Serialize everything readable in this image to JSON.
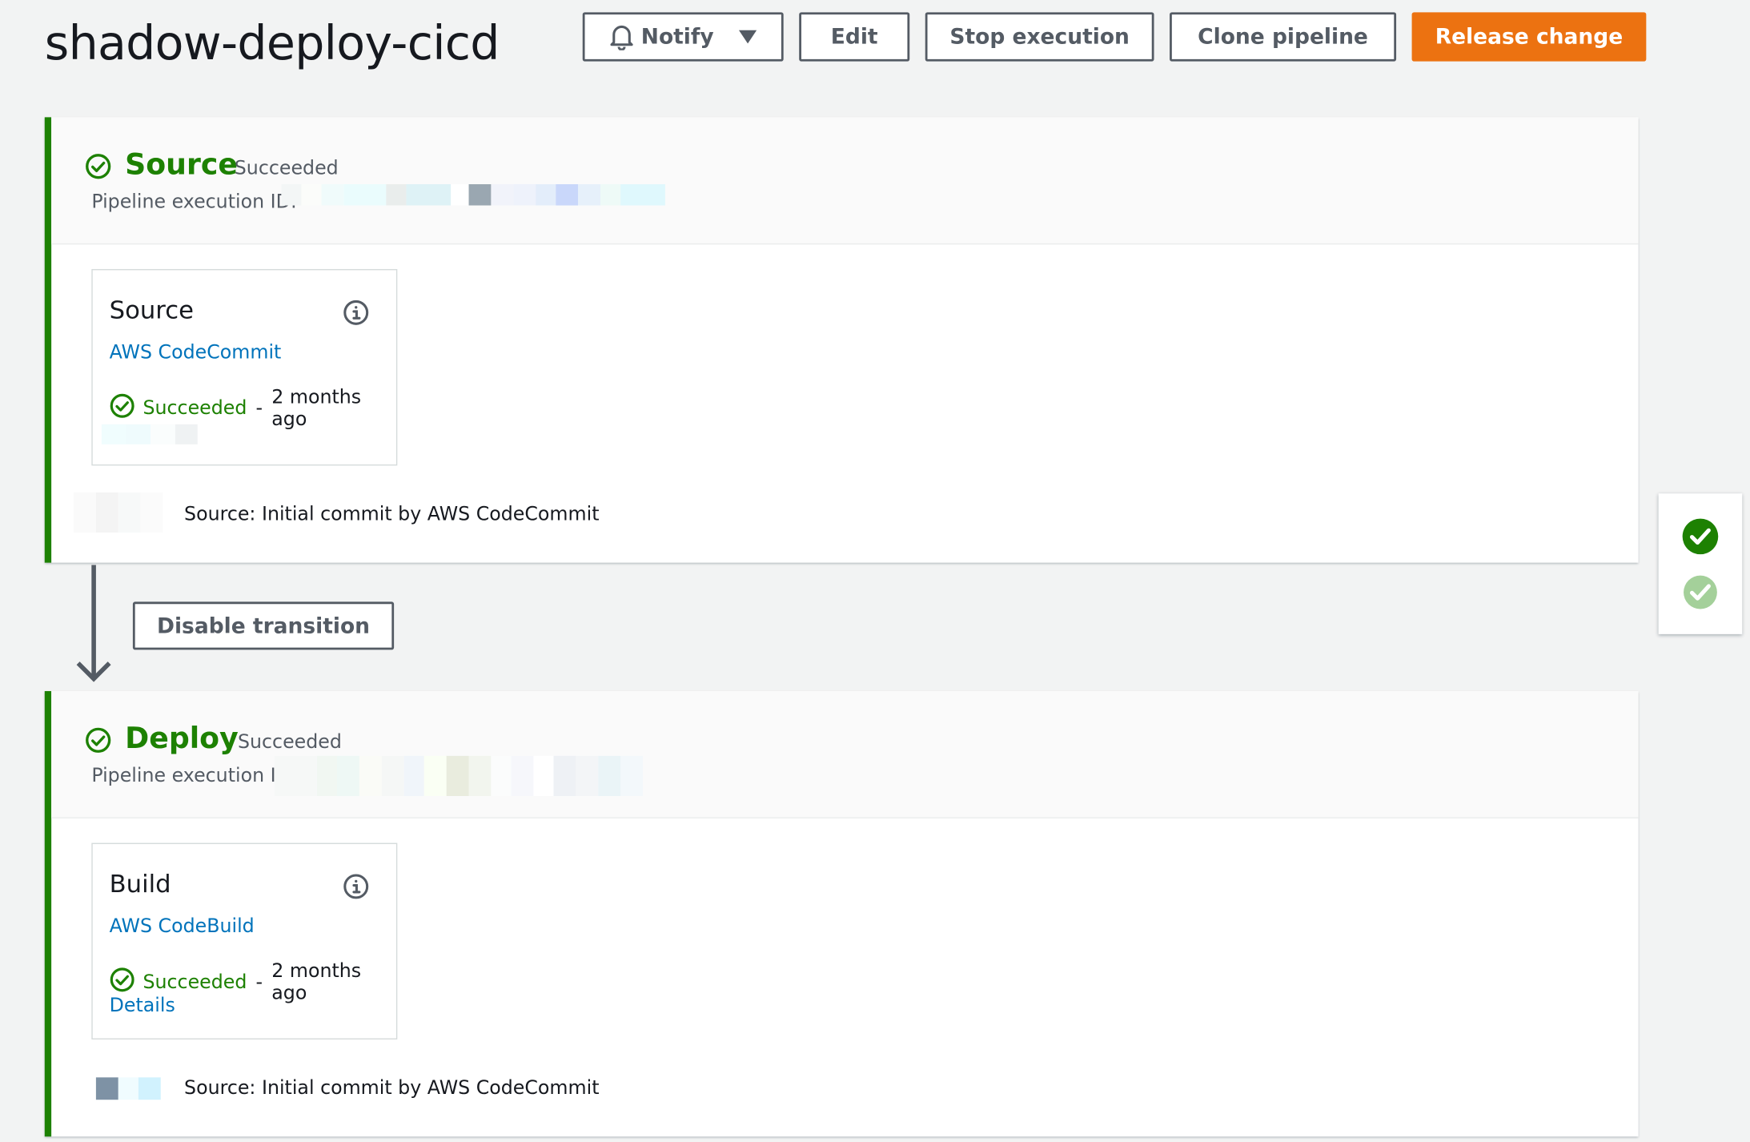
{
  "header": {
    "title": "shadow-deploy-cicd",
    "buttons": {
      "notify": "Notify",
      "edit": "Edit",
      "stop": "Stop execution",
      "clone": "Clone pipeline",
      "release": "Release change"
    }
  },
  "colors": {
    "success": "#1d8102",
    "link": "#0073bb",
    "primary": "#ec7211",
    "muted": "#545b64"
  },
  "stages": [
    {
      "name": "Source",
      "status": "Succeeded",
      "exec_label": "Pipeline execution ID:",
      "action": {
        "title": "Source",
        "provider": "AWS CodeCommit",
        "status": "Succeeded",
        "separator": "-",
        "when": "2 months ago"
      },
      "commit": "Source: Initial commit by AWS CodeCommit"
    },
    {
      "name": "Deploy",
      "status": "Succeeded",
      "exec_label": "Pipeline execution ID:",
      "action": {
        "title": "Build",
        "provider": "AWS CodeBuild",
        "status": "Succeeded",
        "separator": "-",
        "when": "2 months ago",
        "details": "Details"
      },
      "commit": "Source: Initial commit by AWS CodeCommit"
    }
  ],
  "transition": {
    "disable_label": "Disable transition"
  },
  "side_panel": {
    "icons": [
      "check-circle-solid-icon",
      "check-circle-light-icon"
    ]
  }
}
